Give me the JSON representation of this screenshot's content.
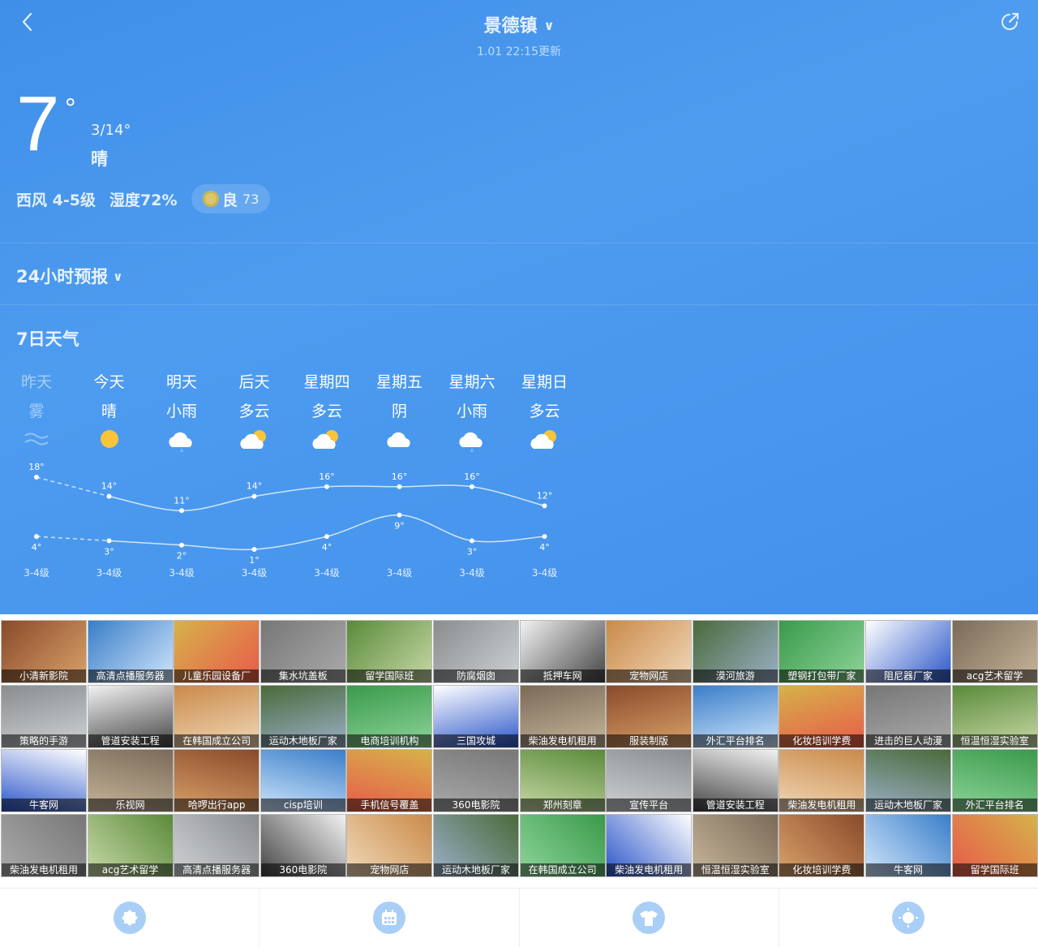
{
  "header": {
    "city": "景德镇",
    "updated": "1.01 22:15更新"
  },
  "current": {
    "temp": "7",
    "deg": "°",
    "range": "3/14°",
    "condition": "晴",
    "wind": "西风 4-5级",
    "humidity": "湿度72%",
    "aqi_label": "良",
    "aqi_value": "73"
  },
  "hourly": {
    "toggle_label": "24小时预报"
  },
  "week": {
    "title": "7日天气",
    "days": [
      {
        "name": "昨天",
        "cond": "雾",
        "icon": "fog-icon",
        "high": "18°",
        "low": "4°",
        "wind": "3-4级"
      },
      {
        "name": "今天",
        "cond": "晴",
        "icon": "sun-icon",
        "high": "14°",
        "low": "3°",
        "wind": "3-4级"
      },
      {
        "name": "明天",
        "cond": "小雨",
        "icon": "rain-icon",
        "high": "11°",
        "low": "2°",
        "wind": "3-4级"
      },
      {
        "name": "后天",
        "cond": "多云",
        "icon": "partly-cloudy-icon",
        "high": "14°",
        "low": "1°",
        "wind": "3-4级"
      },
      {
        "name": "星期四",
        "cond": "多云",
        "icon": "partly-cloudy-icon",
        "high": "16°",
        "low": "4°",
        "wind": "3-4级"
      },
      {
        "name": "星期五",
        "cond": "阴",
        "icon": "cloud-icon",
        "high": "16°",
        "low": "9°",
        "wind": "3-4级"
      },
      {
        "name": "星期六",
        "cond": "小雨",
        "icon": "rain-icon",
        "high": "16°",
        "low": "3°",
        "wind": "3-4级"
      },
      {
        "name": "星期日",
        "cond": "多云",
        "icon": "partly-cloudy-icon",
        "high": "12°",
        "low": "4°",
        "wind": "3-4级"
      }
    ]
  },
  "chart_data": {
    "type": "line",
    "categories": [
      "昨天",
      "今天",
      "明天",
      "后天",
      "星期四",
      "星期五",
      "星期六",
      "星期日"
    ],
    "series": [
      {
        "values": [
          18,
          14,
          11,
          14,
          16,
          16,
          16,
          12
        ]
      },
      {
        "values": [
          4,
          3,
          2,
          1,
          4,
          9,
          3,
          4
        ]
      }
    ]
  },
  "ads": [
    [
      "小清新影院",
      "高清点播服务器",
      "儿童乐园设备厂",
      "集水坑盖板",
      "留学国际班",
      "防腐烟囱",
      "抵押车网",
      "宠物网店",
      "漠河旅游",
      "塑钢打包带厂家",
      "阻尼器厂家",
      "acg艺术留学"
    ],
    [
      "策略的手游",
      "管道安装工程",
      "在韩国成立公司",
      "运动木地板厂家",
      "电商培训机构",
      "三国攻城",
      "柴油发电机租用",
      "服装制版",
      "外汇平台排名",
      "化妆培训学费",
      "进击的巨人动漫",
      "恒温恒湿实验室"
    ],
    [
      "牛客网",
      "乐视网",
      "哈啰出行app",
      "cisp培训",
      "手机信号覆盖",
      "360电影院",
      "郑州刻章",
      "宣传平台",
      "管道安装工程",
      "柴油发电机租用",
      "运动木地板厂家",
      "外汇平台排名"
    ],
    [
      "柴油发电机租用",
      "acg艺术留学",
      "高清点播服务器",
      "360电影院",
      "宠物网店",
      "运动木地板厂家",
      "在韩国成立公司",
      "柴油发电机租用",
      "恒温恒湿实验室",
      "化妆培训学费",
      "牛客网",
      "留学国际班"
    ]
  ],
  "tabs": [
    {
      "icon": "badge-icon"
    },
    {
      "icon": "calendar-icon"
    },
    {
      "icon": "shirt-icon"
    },
    {
      "icon": "sun-icon"
    }
  ]
}
